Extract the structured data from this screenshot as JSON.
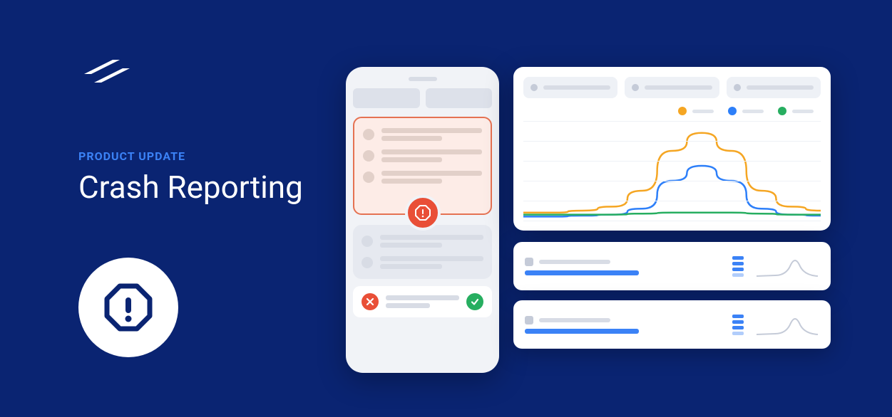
{
  "kicker": "PRODUCT UPDATE",
  "headline": "Crash Reporting",
  "colors": {
    "background": "#0a2472",
    "accent_blue": "#3b82f6",
    "error_red": "#e94f37",
    "success_green": "#27ae60",
    "orange": "#f5a623",
    "chart_blue": "#2d7ff9",
    "chart_green": "#27ae60"
  },
  "chart_data": {
    "type": "line",
    "title": "",
    "xlabel": "",
    "ylabel": "",
    "x": [
      0,
      1,
      2,
      3,
      4,
      5,
      6,
      7,
      8,
      9,
      10
    ],
    "ylim": [
      0,
      100
    ],
    "series": [
      {
        "name": "orange",
        "color": "#f5a623",
        "values": [
          8,
          8,
          10,
          14,
          30,
          70,
          88,
          70,
          30,
          14,
          10
        ]
      },
      {
        "name": "blue",
        "color": "#2d7ff9",
        "values": [
          4,
          4,
          5,
          6,
          12,
          40,
          55,
          40,
          12,
          6,
          5
        ]
      },
      {
        "name": "green",
        "color": "#27ae60",
        "values": [
          6,
          6,
          6,
          6,
          7,
          8,
          8,
          8,
          7,
          6,
          6
        ]
      }
    ]
  }
}
